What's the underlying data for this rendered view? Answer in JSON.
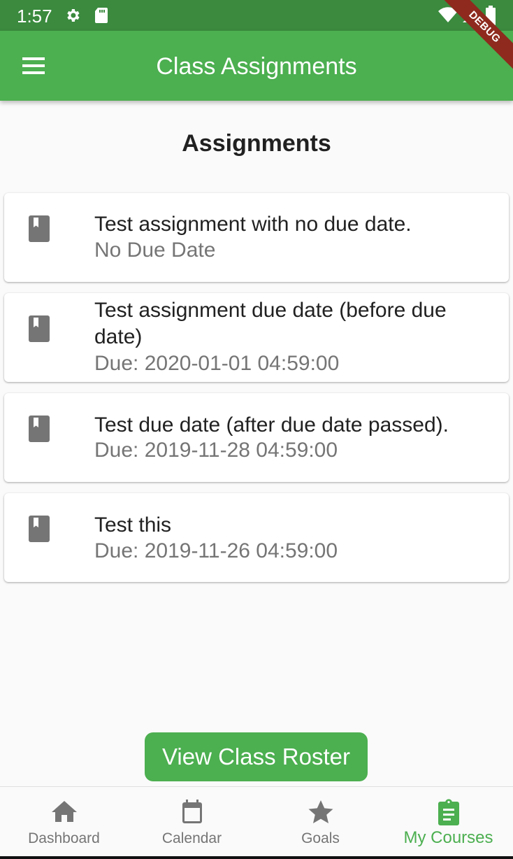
{
  "status_bar": {
    "time": "1:57",
    "icons": [
      "gear-icon",
      "sd-card-icon",
      "wifi-icon",
      "signal-icon",
      "battery-icon"
    ]
  },
  "app_bar": {
    "title": "Class Assignments",
    "menu_icon": "hamburger-menu-icon",
    "debug_banner": "DEBUG"
  },
  "main": {
    "heading": "Assignments",
    "assignments": [
      {
        "title": "Test assignment with no due date.",
        "subtitle": "No Due Date",
        "icon": "book-icon"
      },
      {
        "title": "Test assignment due date (before due date)",
        "subtitle": "Due: 2020-01-01 04:59:00",
        "icon": "book-icon"
      },
      {
        "title": "Test due date (after due date passed).",
        "subtitle": "Due: 2019-11-28 04:59:00",
        "icon": "book-icon"
      },
      {
        "title": "Test this",
        "subtitle": "Due: 2019-11-26 04:59:00",
        "icon": "book-icon"
      }
    ],
    "roster_button_label": "View Class Roster"
  },
  "bottom_nav": {
    "items": [
      {
        "label": "Dashboard",
        "icon": "home-icon",
        "active": false
      },
      {
        "label": "Calendar",
        "icon": "calendar-icon",
        "active": false
      },
      {
        "label": "Goals",
        "icon": "star-icon",
        "active": false
      },
      {
        "label": "My Courses",
        "icon": "clipboard-icon",
        "active": true
      }
    ]
  },
  "colors": {
    "primary": "#4caf50",
    "status_bar": "#3b8a3e",
    "debug_banner": "#8e2a1e",
    "icon_grey": "#757575",
    "subtitle_grey": "#757575"
  }
}
